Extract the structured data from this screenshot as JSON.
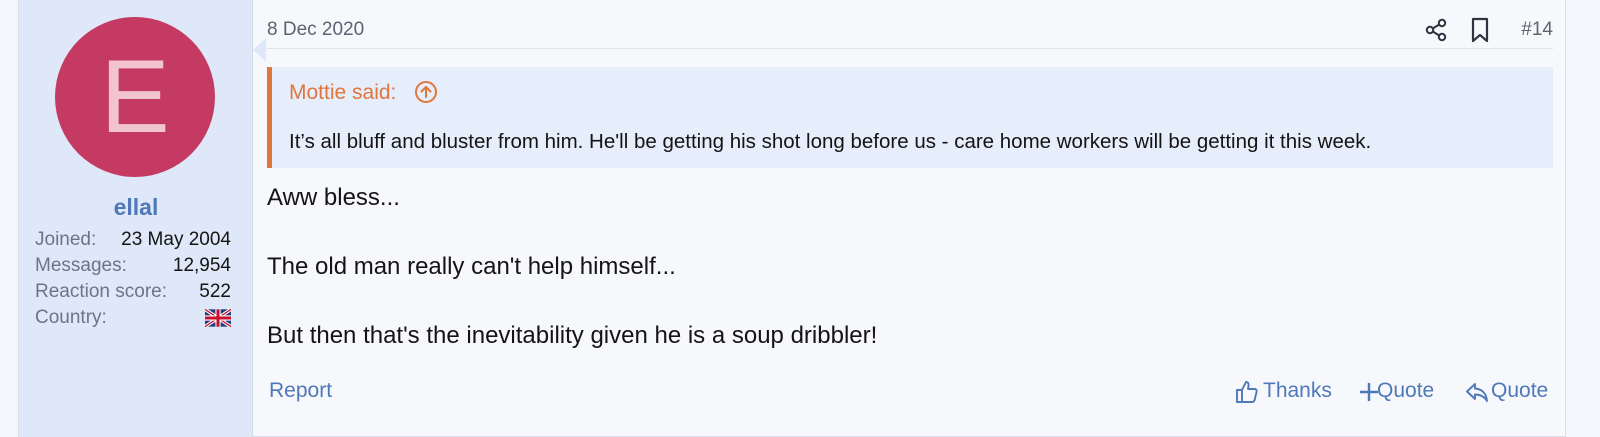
{
  "user": {
    "avatar_letter": "E",
    "avatar_color": "#c43a62",
    "username": "ellal",
    "stats": [
      {
        "label": "Joined:",
        "value": "23 May 2004"
      },
      {
        "label": "Messages:",
        "value": "12,954"
      },
      {
        "label": "Reaction score:",
        "value": "522"
      },
      {
        "label": "Country:",
        "value": ""
      }
    ],
    "country_flag_icon": "uk-flag-icon"
  },
  "post": {
    "date": "8 Dec 2020",
    "number": "#14",
    "share_icon": "share-icon",
    "bookmark_icon": "bookmark-icon"
  },
  "quote": {
    "author": "Mottie said:",
    "jump_icon": "arrow-up-circle-icon",
    "accent_color": "#e0763c",
    "text": "It’s all bluff and bluster from him. He'll be getting his shot long before us - care home workers will be getting it this week."
  },
  "message": {
    "lines": [
      "Aww bless...",
      "The old man really can't help himself...",
      "But then that's the inevitability given he is a soup dribbler!"
    ]
  },
  "footer": {
    "report": "Report",
    "thanks": "Thanks",
    "multiquote": "Quote",
    "quote": "Quote",
    "link_color": "#4f78b8"
  }
}
